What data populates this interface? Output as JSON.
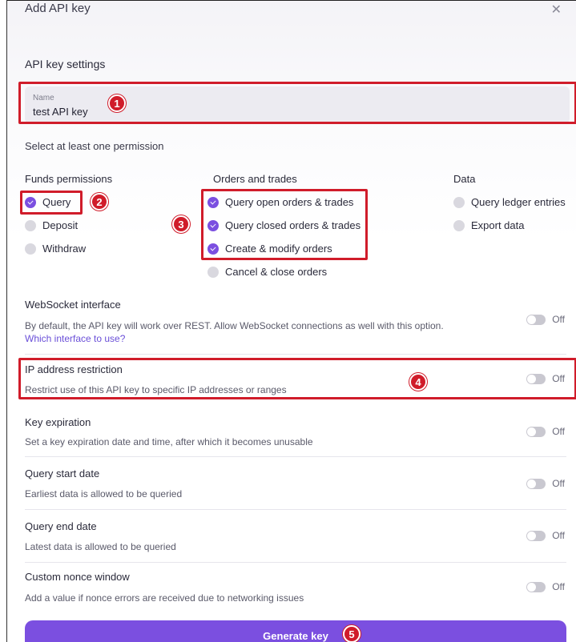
{
  "dialog": {
    "title": "Add API key",
    "close_icon": "close-icon",
    "section_title": "API key settings"
  },
  "name_field": {
    "label": "Name",
    "value": "test API key"
  },
  "permissions_prompt": "Select at least one permission",
  "funds": {
    "heading": "Funds permissions",
    "items": [
      {
        "label": "Query",
        "checked": true
      },
      {
        "label": "Deposit",
        "checked": false
      },
      {
        "label": "Withdraw",
        "checked": false
      }
    ]
  },
  "orders": {
    "heading": "Orders and trades",
    "items": [
      {
        "label": "Query open orders & trades",
        "checked": true
      },
      {
        "label": "Query closed orders & trades",
        "checked": true
      },
      {
        "label": "Create & modify orders",
        "checked": true
      },
      {
        "label": "Cancel & close orders",
        "checked": false
      }
    ]
  },
  "data_perms": {
    "heading": "Data",
    "items": [
      {
        "label": "Query ledger entries",
        "checked": false
      },
      {
        "label": "Export data",
        "checked": false
      }
    ]
  },
  "settings": [
    {
      "title": "WebSocket interface",
      "desc": "By default, the API key will work over REST. Allow WebSocket connections as well with this option.",
      "link": "Which interface to use?",
      "toggle": "Off"
    },
    {
      "title": "IP address restriction",
      "desc": "Restrict use of this API key to specific IP addresses or ranges",
      "toggle": "Off"
    },
    {
      "title": "Key expiration",
      "desc": "Set a key expiration date and time, after which it becomes unusable",
      "toggle": "Off"
    },
    {
      "title": "Query start date",
      "desc": "Earliest data is allowed to be queried",
      "toggle": "Off"
    },
    {
      "title": "Query end date",
      "desc": "Latest data is allowed to be queried",
      "toggle": "Off"
    },
    {
      "title": "Custom nonce window",
      "desc": "Add a value if nonce errors are received due to networking issues",
      "toggle": "Off"
    }
  ],
  "generate_button": "Generate key",
  "annotations": [
    "1",
    "2",
    "3",
    "4",
    "5"
  ],
  "colors": {
    "accent": "#7b4fe0",
    "annotation_red": "#d01c2a"
  }
}
